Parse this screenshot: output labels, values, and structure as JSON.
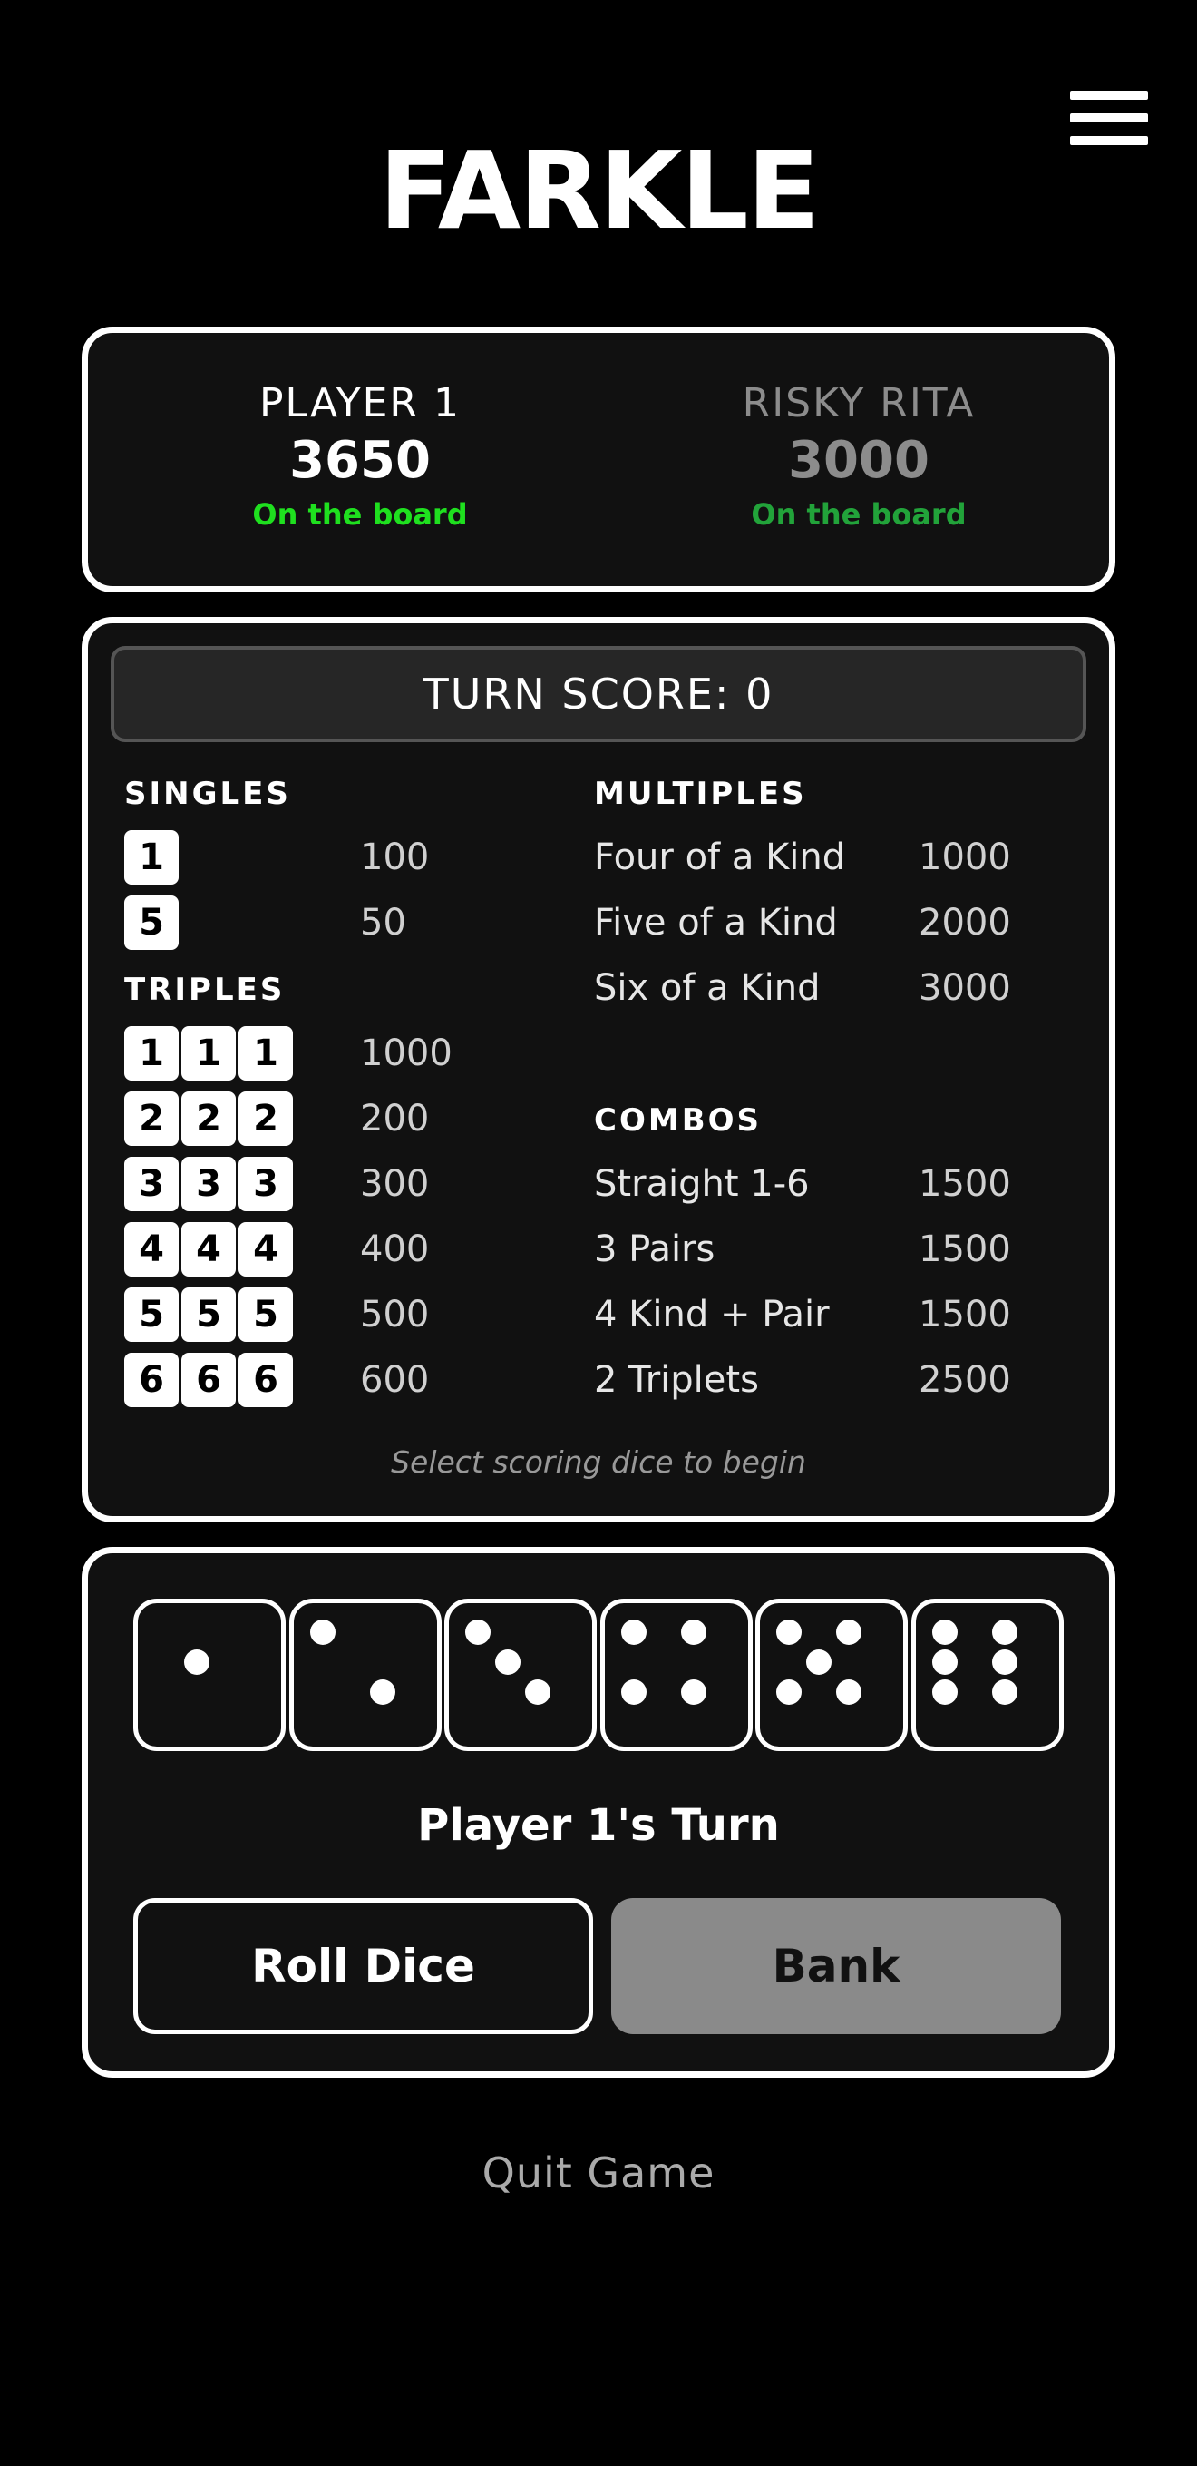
{
  "app": {
    "title": "FARKLE"
  },
  "menu": {
    "icon": "hamburger-menu-icon"
  },
  "players": [
    {
      "name": "PLAYER 1",
      "score": "3650",
      "status": "On the board",
      "status_color": "#1fe01f"
    },
    {
      "name": "RISKY RITA",
      "score": "3000",
      "status": "On the board",
      "status_color": "#22a33a"
    }
  ],
  "turn_score": "TURN SCORE: 0",
  "scoring": {
    "singles_title": "SINGLES",
    "singles": [
      {
        "die": "1",
        "value": "100"
      },
      {
        "die": "5",
        "value": "50"
      }
    ],
    "triples_title": "TRIPLES",
    "triples": [
      {
        "die": "1",
        "value": "1000"
      },
      {
        "die": "2",
        "value": "200"
      },
      {
        "die": "3",
        "value": "300"
      },
      {
        "die": "4",
        "value": "400"
      },
      {
        "die": "5",
        "value": "500"
      },
      {
        "die": "6",
        "value": "600"
      }
    ],
    "multiples_title": "MULTIPLES",
    "multiples": [
      {
        "label": "Four of a Kind",
        "value": "1000"
      },
      {
        "label": "Five of a Kind",
        "value": "2000"
      },
      {
        "label": "Six of a Kind",
        "value": "3000"
      }
    ],
    "combos_title": "COMBOS",
    "combos": [
      {
        "label": "Straight 1-6",
        "value": "1500"
      },
      {
        "label": "3 Pairs",
        "value": "1500"
      },
      {
        "label": "4 Kind + Pair",
        "value": "1500"
      },
      {
        "label": "2 Triplets",
        "value": "2500"
      }
    ],
    "hint": "Select scoring dice to begin"
  },
  "dice": [
    1,
    2,
    3,
    4,
    5,
    6
  ],
  "turn_label": "Player 1's Turn",
  "buttons": {
    "roll": "Roll Dice",
    "bank": "Bank"
  },
  "quit": "Quit Game"
}
